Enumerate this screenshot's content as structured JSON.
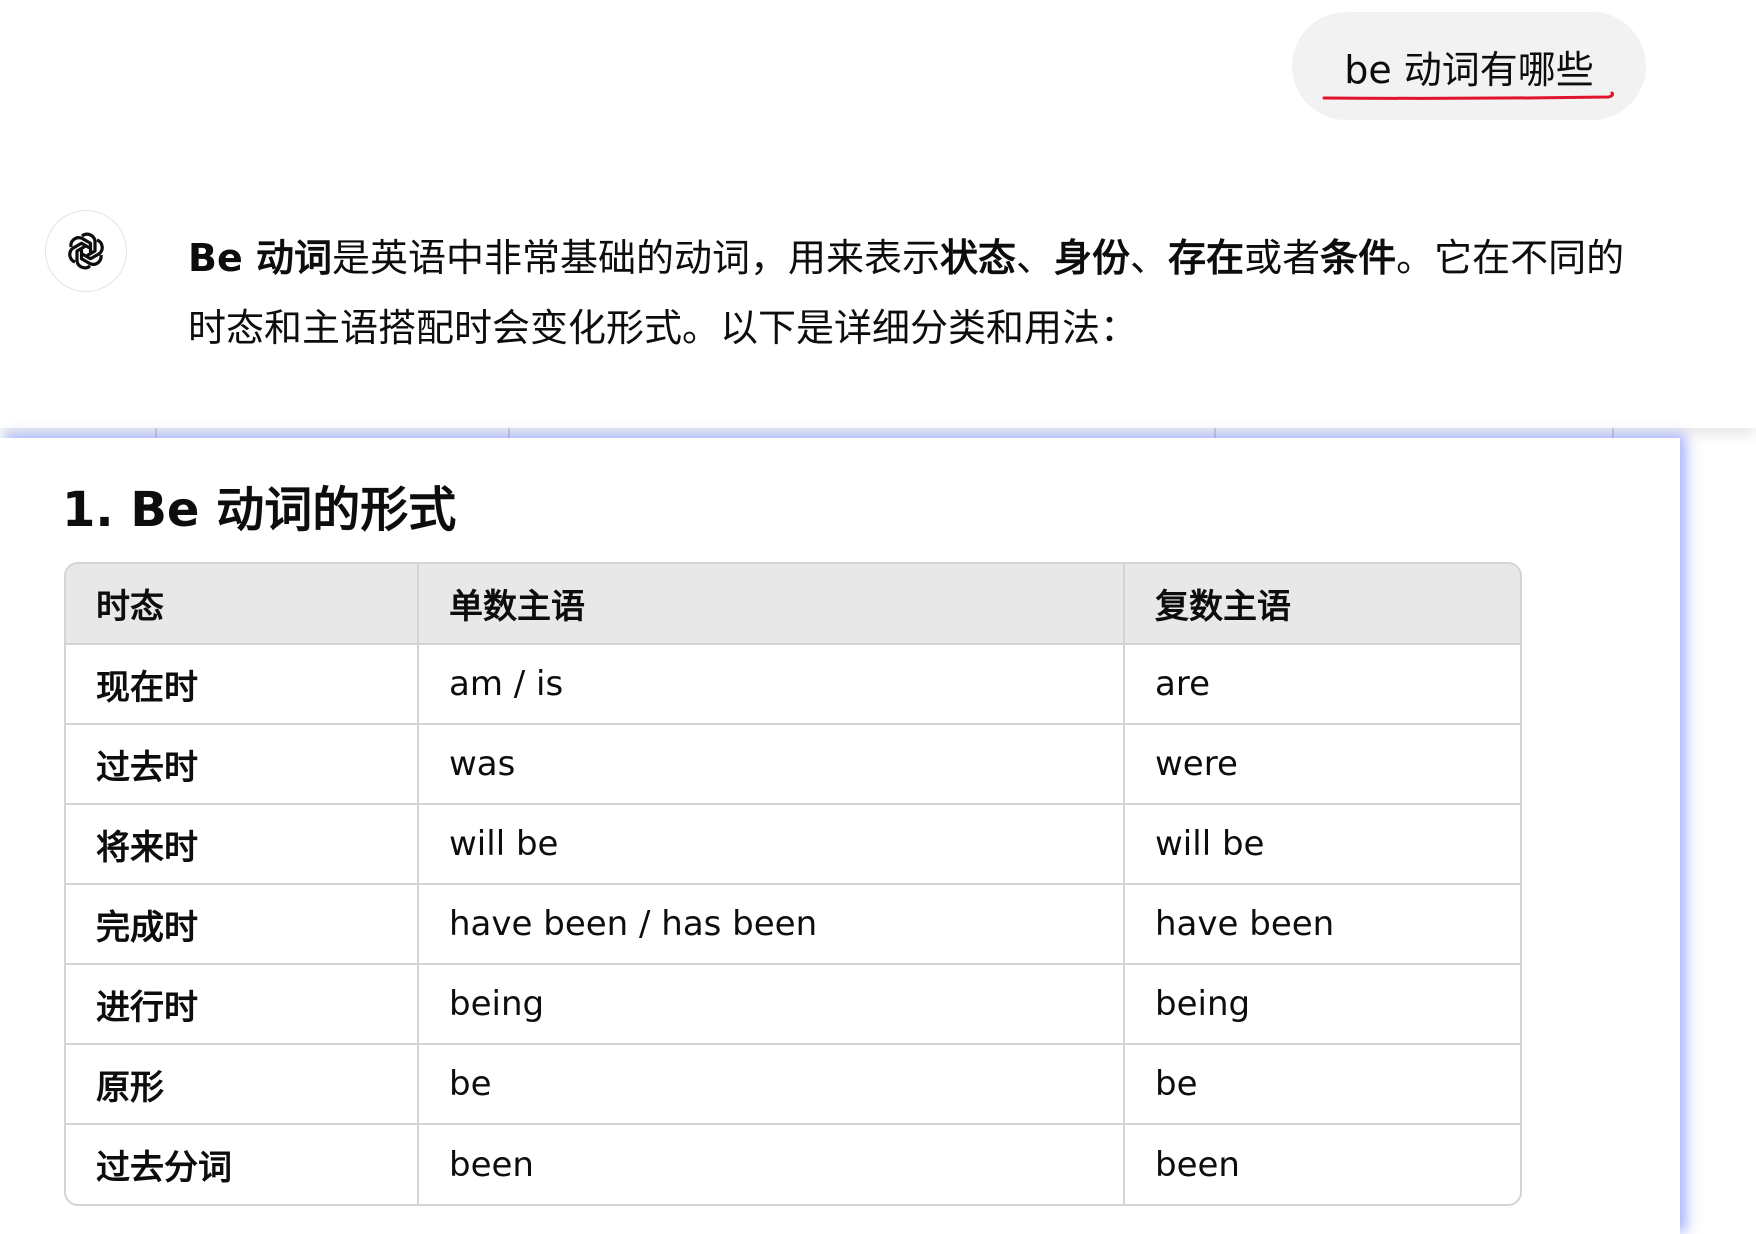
{
  "user_message": "be 动词有哪些",
  "assistant": {
    "avatar_icon": "openai-logo-icon",
    "intro_parts": [
      {
        "text": "Be 动词",
        "bold": true
      },
      {
        "text": "是英语中非常基础的动词，用来表示",
        "bold": false
      },
      {
        "text": "状态",
        "bold": true
      },
      {
        "text": "、",
        "bold": false
      },
      {
        "text": "身份",
        "bold": true
      },
      {
        "text": "、",
        "bold": false
      },
      {
        "text": "存在",
        "bold": true
      },
      {
        "text": "或者",
        "bold": false
      },
      {
        "text": "条件",
        "bold": true
      },
      {
        "text": "。它在不同的时态和主语搭配时会变化形式。以下是详细分类和用法：",
        "bold": false
      }
    ]
  },
  "section": {
    "heading": "1. Be 动词的形式",
    "table": {
      "headers": [
        "时态",
        "单数主语",
        "复数主语"
      ],
      "rows": [
        [
          "现在时",
          "am / is",
          "are"
        ],
        [
          "过去时",
          "was",
          "were"
        ],
        [
          "将来时",
          "will be",
          "will be"
        ],
        [
          "完成时",
          "have been / has been",
          "have been"
        ],
        [
          "进行时",
          "being",
          "being"
        ],
        [
          "原形",
          "be",
          "be"
        ],
        [
          "过去分词",
          "been",
          "been"
        ]
      ]
    }
  },
  "colors": {
    "user_bubble_bg": "#f2f2f2",
    "annotation_underline": "#e0132b",
    "table_header_bg": "#e8e8e8",
    "table_border": "#d4d4d4",
    "overlay_glow": "#788cff"
  }
}
